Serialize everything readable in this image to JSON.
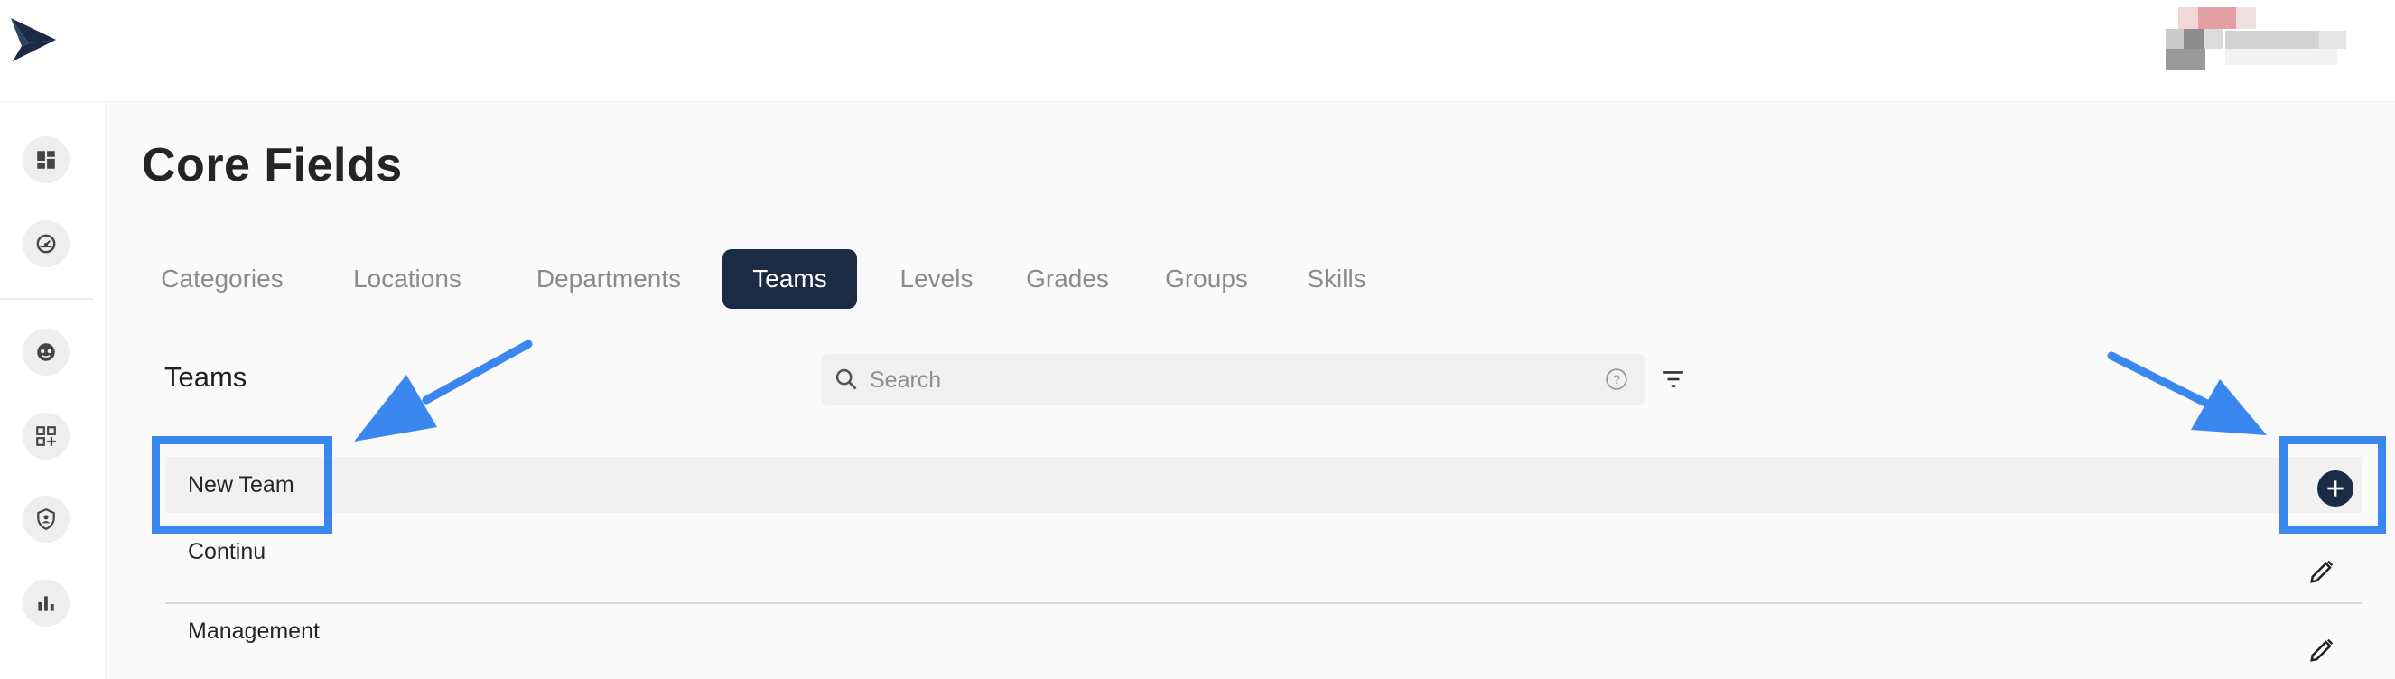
{
  "header": {
    "logo_icon": "chevron-arrow-logo",
    "user_avatar_icon": "pixelated-user"
  },
  "sidebar": {
    "items": [
      {
        "icon": "dashboard-icon"
      },
      {
        "icon": "speedometer-icon"
      },
      {
        "icon": "face-icon"
      },
      {
        "icon": "apps-add-icon"
      },
      {
        "icon": "shield-person-icon"
      },
      {
        "icon": "bar-chart-icon"
      }
    ]
  },
  "page": {
    "title": "Core Fields"
  },
  "tabs": [
    {
      "label": "Categories",
      "active": false
    },
    {
      "label": "Locations",
      "active": false
    },
    {
      "label": "Departments",
      "active": false
    },
    {
      "label": "Teams",
      "active": true
    },
    {
      "label": "Levels",
      "active": false
    },
    {
      "label": "Grades",
      "active": false
    },
    {
      "label": "Groups",
      "active": false
    },
    {
      "label": "Skills",
      "active": false
    }
  ],
  "section": {
    "title": "Teams",
    "search_placeholder": "Search"
  },
  "new_row": {
    "label": "New Team"
  },
  "rows": [
    {
      "label": "Continu"
    },
    {
      "label": "Management"
    }
  ],
  "colors": {
    "accent": "#1b2a45",
    "annotation": "#3b87f0"
  }
}
